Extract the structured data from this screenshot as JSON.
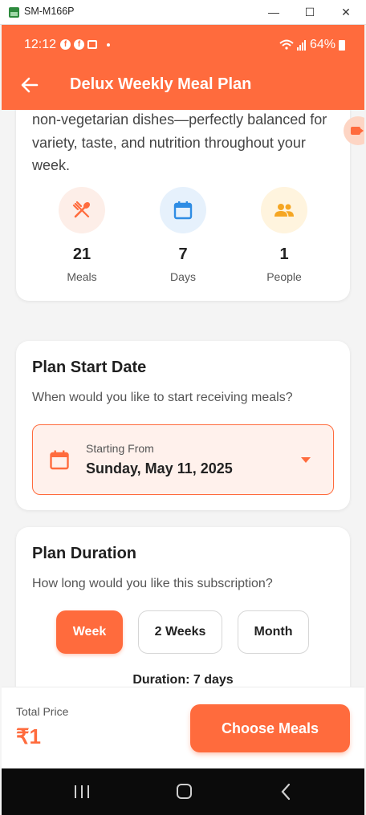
{
  "window": {
    "title": "SM-M166P",
    "minimize": "—",
    "maximize": "☐",
    "close": "✕"
  },
  "status_bar": {
    "time": "12:12",
    "battery": "64%"
  },
  "header": {
    "title": "Delux Weekly Meal Plan",
    "back_icon": "arrow-back-icon"
  },
  "overview": {
    "description": "non-vegetarian dishes—perfectly balanced for variety, taste, and nutrition throughout your week.",
    "stats": [
      {
        "value": "21",
        "label": "Meals",
        "icon": "fork-spoon-icon",
        "bg": "#fdeee8"
      },
      {
        "value": "7",
        "label": "Days",
        "icon": "calendar-icon",
        "bg": "#e6f1fc"
      },
      {
        "value": "1",
        "label": "People",
        "icon": "people-icon",
        "bg": "#fff4de"
      }
    ]
  },
  "start_date": {
    "title": "Plan Start Date",
    "subtitle": "When would you like to start receiving meals?",
    "field_label": "Starting From",
    "value": "Sunday, May 11, 2025"
  },
  "duration": {
    "title": "Plan Duration",
    "subtitle": "How long would you like this subscription?",
    "options": [
      "Week",
      "2 Weeks",
      "Month"
    ],
    "selected": "Week",
    "summary": "Duration: 7 days"
  },
  "footer": {
    "total_label": "Total Price",
    "total_value": "₹1",
    "cta": "Choose Meals"
  },
  "colors": {
    "accent": "#ff6b3d",
    "meals_icon": "#ff6b3d",
    "days_icon": "#2f8de4",
    "people_icon": "#f5a623"
  }
}
